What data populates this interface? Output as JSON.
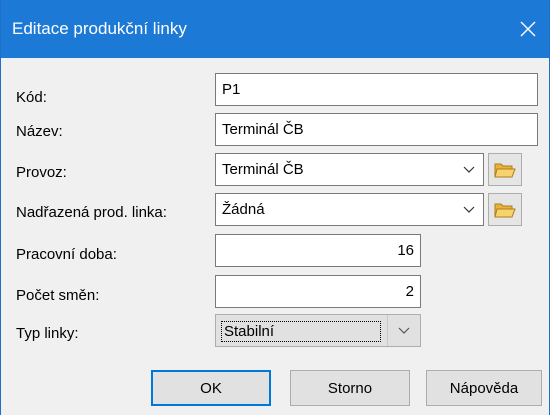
{
  "window": {
    "title": "Editace produkční linky"
  },
  "form": {
    "kod": {
      "label": "Kód:",
      "value": "P1"
    },
    "nazev": {
      "label": "Název:",
      "value": "Terminál ČB"
    },
    "provoz": {
      "label": "Provoz:",
      "value": "Terminál ČB"
    },
    "nadrazena": {
      "label": "Nadřazená prod. linka:",
      "value": "Žádná"
    },
    "pracovni_doba": {
      "label": "Pracovní doba:",
      "value": "16"
    },
    "pocet_smen": {
      "label": "Počet směn:",
      "value": "2"
    },
    "typ_linky": {
      "label": "Typ linky:",
      "value": "Stabilní"
    }
  },
  "buttons": {
    "ok": "OK",
    "storno": "Storno",
    "napoveda": "Nápověda"
  },
  "colors": {
    "titlebar": "#1d79d6",
    "default_button_border": "#0078d7",
    "folder_icon": "#f2c14e"
  },
  "icons": {
    "close": "close-icon",
    "dropdown": "chevron-down-icon",
    "browse": "folder-open-icon"
  }
}
